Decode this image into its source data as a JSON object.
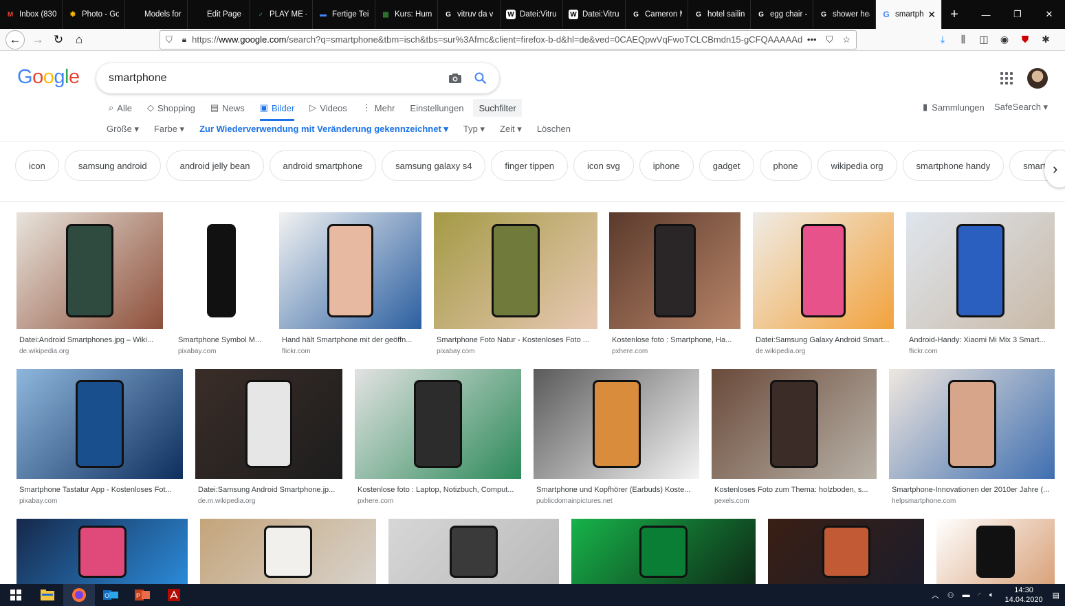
{
  "browser": {
    "tabs": [
      {
        "label": "Inbox (830",
        "color": "#ea4335",
        "glyph": "M"
      },
      {
        "label": "Photo - Go",
        "color": "#fbbc05",
        "glyph": "✱"
      },
      {
        "label": "Models for HCI",
        "color": "#0c0c0d",
        "glyph": ""
      },
      {
        "label": "Edit Page ‹ HCI",
        "color": "#0c0c0d",
        "glyph": ""
      },
      {
        "label": "PLAY ME -",
        "color": "#34a853",
        "glyph": "♂"
      },
      {
        "label": "Fertige Tei",
        "color": "#4285f4",
        "glyph": "▬"
      },
      {
        "label": "Kurs: Hum",
        "color": "#2e7d32",
        "glyph": "▦"
      },
      {
        "label": "vitruv da v",
        "color": "#fff",
        "glyph": "G"
      },
      {
        "label": "Datei:Vitru",
        "color": "#fff",
        "glyph": "W"
      },
      {
        "label": "Datei:Vitru",
        "color": "#fff",
        "glyph": "W"
      },
      {
        "label": "Cameron M",
        "color": "#fff",
        "glyph": "G"
      },
      {
        "label": "hotel sailin",
        "color": "#fff",
        "glyph": "G"
      },
      {
        "label": "egg chair -",
        "color": "#fff",
        "glyph": "G"
      },
      {
        "label": "shower hea",
        "color": "#fff",
        "glyph": "G"
      }
    ],
    "active_tab": {
      "label": "smartph",
      "close": "✕"
    },
    "new_tab": "+",
    "url_domain": "www.google.com",
    "url_prefix": "https://",
    "url_rest": "/search?q=smartphone&tbm=isch&tbs=sur%3Afmc&client=firefox-b-d&hl=de&ved=0CAEQpwVqFwoTCLCBmdn15-gCFQAAAAAd",
    "url_more": "•••"
  },
  "google": {
    "query": "smartphone",
    "tabs": [
      {
        "label": "Alle",
        "icon": "search-icon"
      },
      {
        "label": "Shopping",
        "icon": "tag-icon"
      },
      {
        "label": "News",
        "icon": "news-icon"
      },
      {
        "label": "Bilder",
        "icon": "image-icon"
      },
      {
        "label": "Videos",
        "icon": "video-icon"
      },
      {
        "label": "Mehr",
        "icon": "more-icon"
      }
    ],
    "settings": "Einstellungen",
    "suchfilter": "Suchfilter",
    "sammlungen": "Sammlungen",
    "safesearch": "SafeSearch ▾",
    "filters": [
      "Größe ▾",
      "Farbe ▾",
      "Zur Wiederverwendung mit Veränderung gekennzeichnet ▾",
      "Typ ▾",
      "Zeit ▾",
      "Löschen"
    ],
    "chips": [
      "icon",
      "samsung android",
      "android jelly bean",
      "android smartphone",
      "samsung galaxy s4",
      "finger tippen",
      "icon svg",
      "iphone",
      "gadget",
      "phone",
      "wikipedia org",
      "smartphone handy",
      "smartphone"
    ]
  },
  "results": [
    {
      "title": "Datei:Android Smartphones.jpg – Wiki...",
      "source": "de.wikipedia.org",
      "palette": [
        "#e8e4dc",
        "#2f4a3e",
        "#8e4f3a"
      ]
    },
    {
      "title": "Smartphone Symbol M...",
      "source": "pixabay.com",
      "palette": [
        "#ffffff",
        "#111111",
        "#ffffff"
      ]
    },
    {
      "title": "Hand hält Smartphone mit der geöffn...",
      "source": "flickr.com",
      "palette": [
        "#f2f2f2",
        "#e7b9a0",
        "#2b5fa0"
      ]
    },
    {
      "title": "Smartphone Foto Natur - Kostenloses Foto ...",
      "source": "pixabay.com",
      "palette": [
        "#a49a45",
        "#6f7a3b",
        "#e8c9b4"
      ]
    },
    {
      "title": "Kostenlose foto : Smartphone, Ha...",
      "source": "pxhere.com",
      "palette": [
        "#5b3a2c",
        "#2a2628",
        "#b78468"
      ]
    },
    {
      "title": "Datei:Samsung Galaxy Android Smart...",
      "source": "de.wikipedia.org",
      "palette": [
        "#efece6",
        "#e8528a",
        "#f2a23c"
      ]
    },
    {
      "title": "Android-Handy: Xiaomi Mi Mix 3 Smart...",
      "source": "flickr.com",
      "palette": [
        "#dfe6ee",
        "#2b5fbf",
        "#c9b9a7"
      ]
    },
    {
      "title": "Smartphone Tastatur App - Kostenloses Fot...",
      "source": "pixabay.com",
      "palette": [
        "#8fb7dd",
        "#1a4f8e",
        "#0e2f5e"
      ]
    },
    {
      "title": "Datei:Samsung Android Smartphone.jp...",
      "source": "de.m.wikipedia.org",
      "palette": [
        "#3a2d28",
        "#e6e6e6",
        "#1d1d1d"
      ]
    },
    {
      "title": "Kostenlose foto : Laptop, Notizbuch, Comput...",
      "source": "pxhere.com",
      "palette": [
        "#e2e2e2",
        "#2c2c2c",
        "#2d8a5a"
      ]
    },
    {
      "title": "Smartphone und Kopfhörer (Earbuds) Koste...",
      "source": "publicdomainpictures.net",
      "palette": [
        "#5a5a5a",
        "#d98c3c",
        "#f4f4f4"
      ]
    },
    {
      "title": "Kostenloses Foto zum Thema: holzboden, s...",
      "source": "pexels.com",
      "palette": [
        "#6a4a3a",
        "#3c2c28",
        "#b9b2a8"
      ]
    },
    {
      "title": "Smartphone-Innovationen der 2010er Jahre (...",
      "source": "helpsmartphone.com",
      "palette": [
        "#efe7df",
        "#d6a58a",
        "#3f6fb0"
      ]
    },
    {
      "title": "",
      "source": "",
      "palette": [
        "#16284a",
        "#e04a7a",
        "#2b8ad8"
      ]
    },
    {
      "title": "",
      "source": "",
      "palette": [
        "#c4a47a",
        "#f2f0ec",
        "#d8d3cc"
      ]
    },
    {
      "title": "",
      "source": "",
      "palette": [
        "#d7d7d7",
        "#3a3a3a",
        "#b9b9b9"
      ]
    },
    {
      "title": "",
      "source": "",
      "palette": [
        "#17b34a",
        "#0a7e34",
        "#0e2a16"
      ]
    },
    {
      "title": "",
      "source": "",
      "palette": [
        "#3a1f14",
        "#c25a35",
        "#1c1c2a"
      ]
    },
    {
      "title": "",
      "source": "",
      "palette": [
        "#ffffff",
        "#111111",
        "#d9a27a"
      ]
    }
  ],
  "taskbar": {
    "time": "14:30",
    "date": "14.04.2020"
  }
}
